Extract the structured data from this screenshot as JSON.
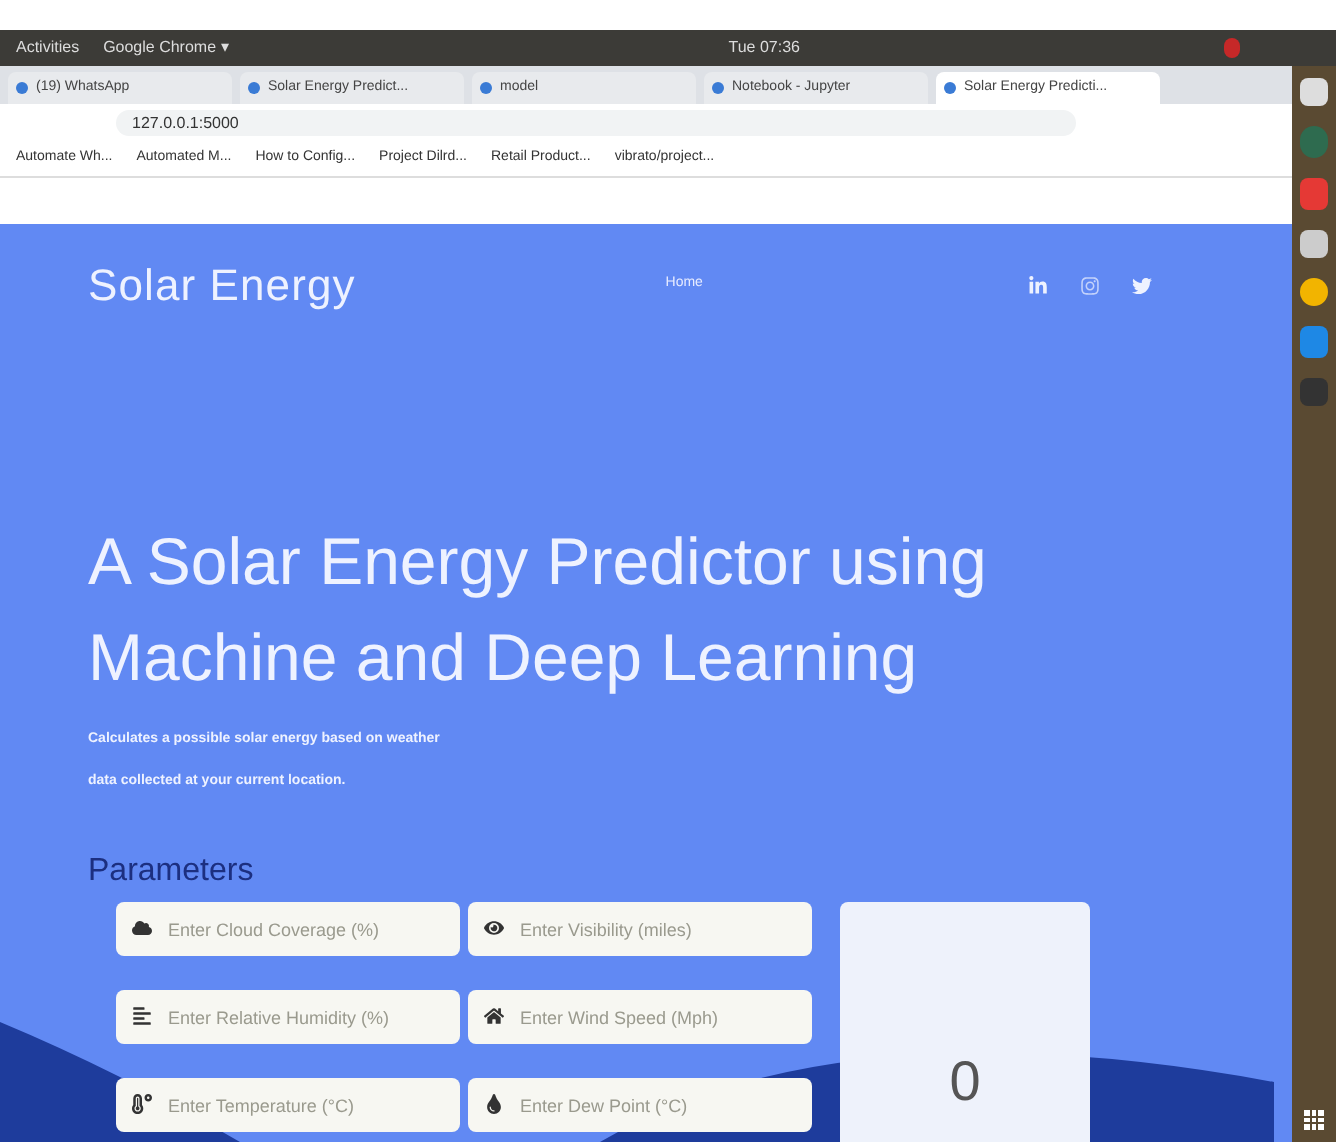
{
  "top_bar": {
    "activities": "Activities",
    "app_menu": "Google Chrome ▾",
    "clock": "Tue 07:36"
  },
  "tabs": [
    {
      "label": "(19) WhatsApp",
      "selected": false
    },
    {
      "label": "Solar Energy Predict...",
      "selected": false
    },
    {
      "label": "model",
      "selected": false
    },
    {
      "label": "Notebook - Jupyter",
      "selected": false
    },
    {
      "label": "Solar Energy Predicti...",
      "selected": true
    }
  ],
  "address_bar": {
    "url": "127.0.0.1:5000"
  },
  "bookmarks": [
    "Automate Wh...",
    "Automated M...",
    "How to Config...",
    "Project Dilrd...",
    "Retail Product...",
    "vibrato/project..."
  ],
  "site": {
    "brand": "Solar Energy",
    "nav": [
      "Home"
    ],
    "hero_title": "A Solar Energy Predictor using Machine and Deep Learning",
    "subtitle": [
      "Calculates a possible solar energy based on weather",
      "data collected at your current location."
    ],
    "parameters_heading": "Parameters",
    "fields": [
      {
        "placeholder": "Enter Cloud Coverage (%)",
        "kind": "cloud"
      },
      {
        "placeholder": "Enter Visibility (miles)",
        "kind": "eye"
      },
      {
        "placeholder": "Enter Relative Humidity (%)",
        "kind": "lines"
      },
      {
        "placeholder": "Enter Wind Speed (Mph)",
        "kind": "home"
      },
      {
        "placeholder": "Enter Temperature (°C)",
        "kind": "temp"
      },
      {
        "placeholder": "Enter Dew Point (°C)",
        "kind": "drop"
      }
    ],
    "result": "0"
  }
}
